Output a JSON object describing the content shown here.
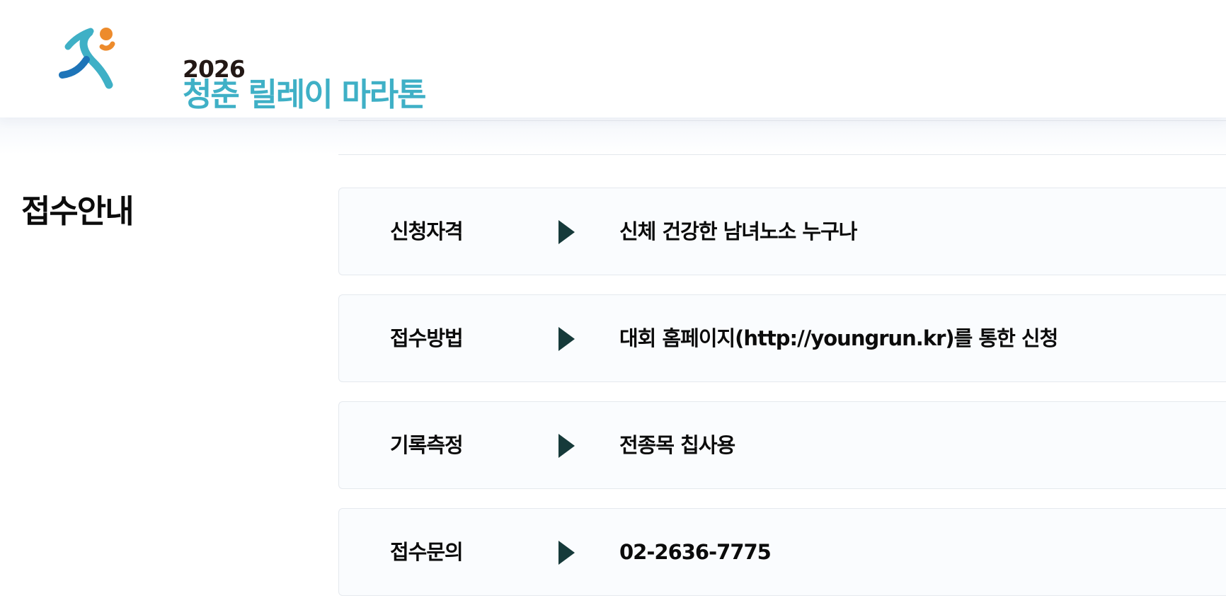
{
  "header": {
    "logo": {
      "year": "2026",
      "title": "청춘 릴레이 마라톤"
    }
  },
  "section": {
    "title": "접수안내"
  },
  "info_rows": [
    {
      "label": "신청자격",
      "value": "신체 건강한 남녀노소 누구나"
    },
    {
      "label": "접수방법",
      "value": "대회 홈페이지(http://youngrun.kr)를 통한 신청"
    },
    {
      "label": "기록측정",
      "value": "전종목 칩사용"
    },
    {
      "label": "접수문의",
      "value": "02-2636-7775"
    }
  ],
  "icons": {
    "row_marker": "play-triangle-icon",
    "logo_mark": "runner-icon"
  },
  "colors": {
    "logo_teal": "#3fb0c6",
    "logo_blue": "#1d74b8",
    "logo_orange": "#ed8b2c",
    "logo_dark": "#231815",
    "arrow": "#163a3a",
    "row_bg": "#fafcfe",
    "row_border": "#e5e9ee"
  }
}
